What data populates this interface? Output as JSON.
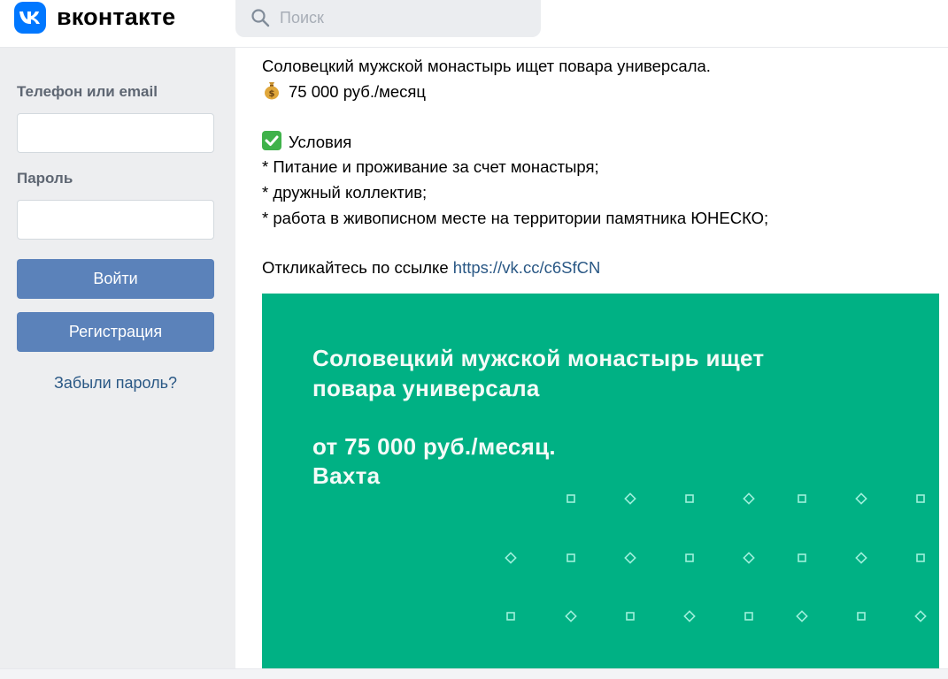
{
  "header": {
    "brand": "вконтакте",
    "logo_text": "VK",
    "search_placeholder": "Поиск"
  },
  "sidebar": {
    "phone_label": "Телефон или email",
    "password_label": "Пароль",
    "login_button": "Войти",
    "register_button": "Регистрация",
    "forgot_link": "Забыли пароль?"
  },
  "post": {
    "title": "Соловецкий мужской монастырь ищет повара универсала.",
    "salary_emoji": "💰",
    "salary": "75 000 руб./месяц",
    "conditions_emoji": "✅",
    "conditions": "Условия",
    "item1": "* Питание и проживание за счет монастыря;",
    "item2": "* дружный коллектив;",
    "item3": "* работа в живописном месте на территории памятника ЮНЕСКО;",
    "respond_text": "Откликайтесь по ссылке ",
    "respond_link": "https://vk.cc/c6SfCN"
  },
  "banner": {
    "line1": "Соловецкий  мужской монастырь ищет",
    "line2": "повара универсала",
    "line3": "от 75 000 руб./месяц.",
    "line4": "Вахта"
  },
  "colors": {
    "vk_blue": "#0077ff",
    "button": "#5b82ba",
    "link": "#2a5885",
    "banner_green": "#00b184"
  }
}
